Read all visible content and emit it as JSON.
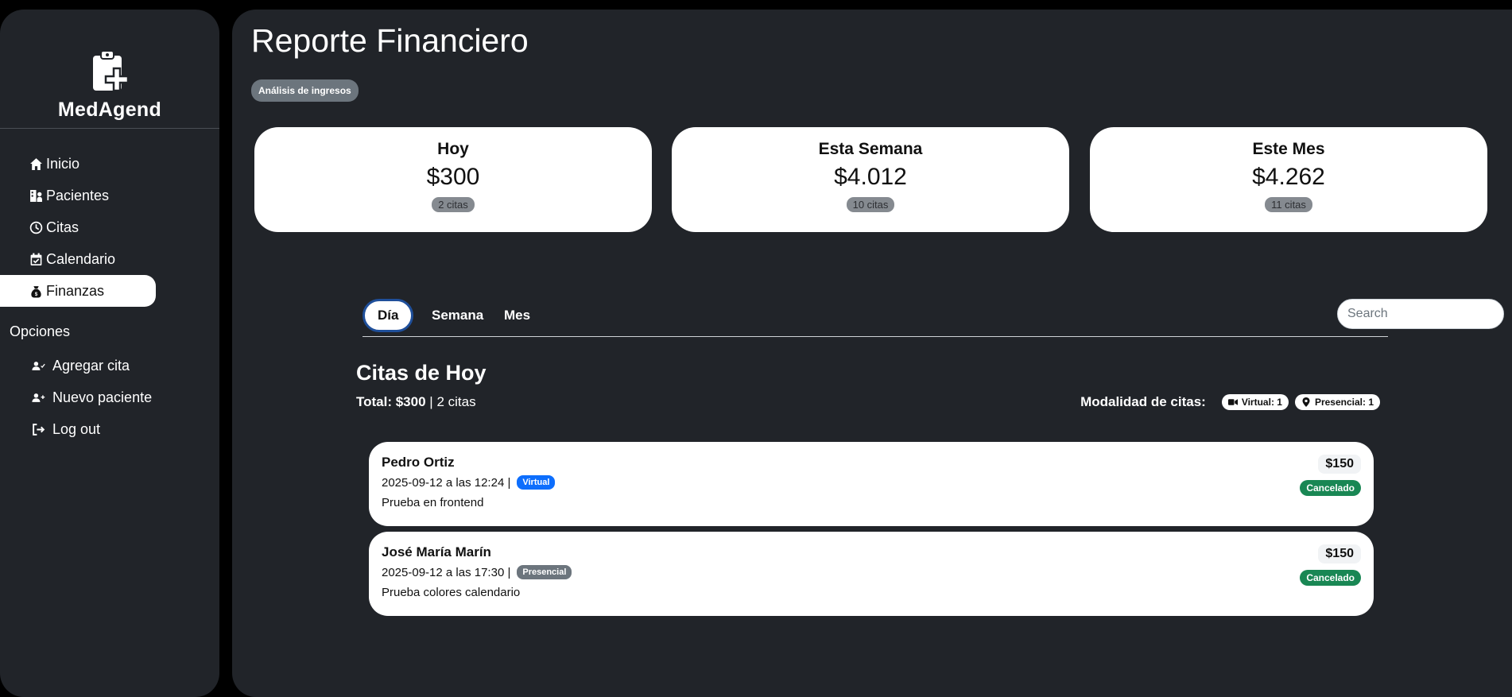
{
  "brand": {
    "name": "MedAgend",
    "icon": "clipboard-plus-icon"
  },
  "sidebar": {
    "items": [
      {
        "label": "Inicio",
        "icon": "home-icon"
      },
      {
        "label": "Pacientes",
        "icon": "patients-icon"
      },
      {
        "label": "Citas",
        "icon": "clock-icon"
      },
      {
        "label": "Calendario",
        "icon": "calendar-check-icon"
      },
      {
        "label": "Finanzas",
        "icon": "money-bag-icon",
        "active": true
      }
    ],
    "options_label": "Opciones",
    "options": [
      {
        "label": "Agregar cita",
        "icon": "user-check-icon"
      },
      {
        "label": "Nuevo paciente",
        "icon": "user-plus-icon"
      },
      {
        "label": "Log out",
        "icon": "logout-icon"
      }
    ]
  },
  "header": {
    "title": "Reporte Financiero",
    "badge": "Análisis de ingresos"
  },
  "stats": [
    {
      "label": "Hoy",
      "amount": "$300",
      "count": "2 citas"
    },
    {
      "label": "Esta Semana",
      "amount": "$4.012",
      "count": "10 citas"
    },
    {
      "label": "Este Mes",
      "amount": "$4.262",
      "count": "11 citas"
    }
  ],
  "tabs": [
    {
      "label": "Día",
      "active": true
    },
    {
      "label": "Semana",
      "active": false
    },
    {
      "label": "Mes",
      "active": false
    }
  ],
  "search": {
    "placeholder": "Search",
    "value": ""
  },
  "today": {
    "title": "Citas de Hoy",
    "total_label": "Total: $300",
    "separator": "|",
    "count": "2 citas",
    "modality_label": "Modalidad de citas:",
    "virtual_badge": "Virtual: 1",
    "presencial_badge": "Presencial: 1"
  },
  "appointments": [
    {
      "name": "Pedro Ortiz",
      "datetime": "2025-09-12 a las 12:24 |",
      "mode": "Virtual",
      "note": "Prueba en frontend",
      "price": "$150",
      "status": "Cancelado"
    },
    {
      "name": "José María Marín",
      "datetime": "2025-09-12 a las 17:30 |",
      "mode": "Presencial",
      "note": "Prueba colores calendario",
      "price": "$150",
      "status": "Cancelado"
    }
  ],
  "colors": {
    "panel": "#212429",
    "virtual": "#0d6efd",
    "presencial": "#6c757d",
    "status_cancelado": "#198754",
    "active_tab_border": "#1f4f9a"
  }
}
